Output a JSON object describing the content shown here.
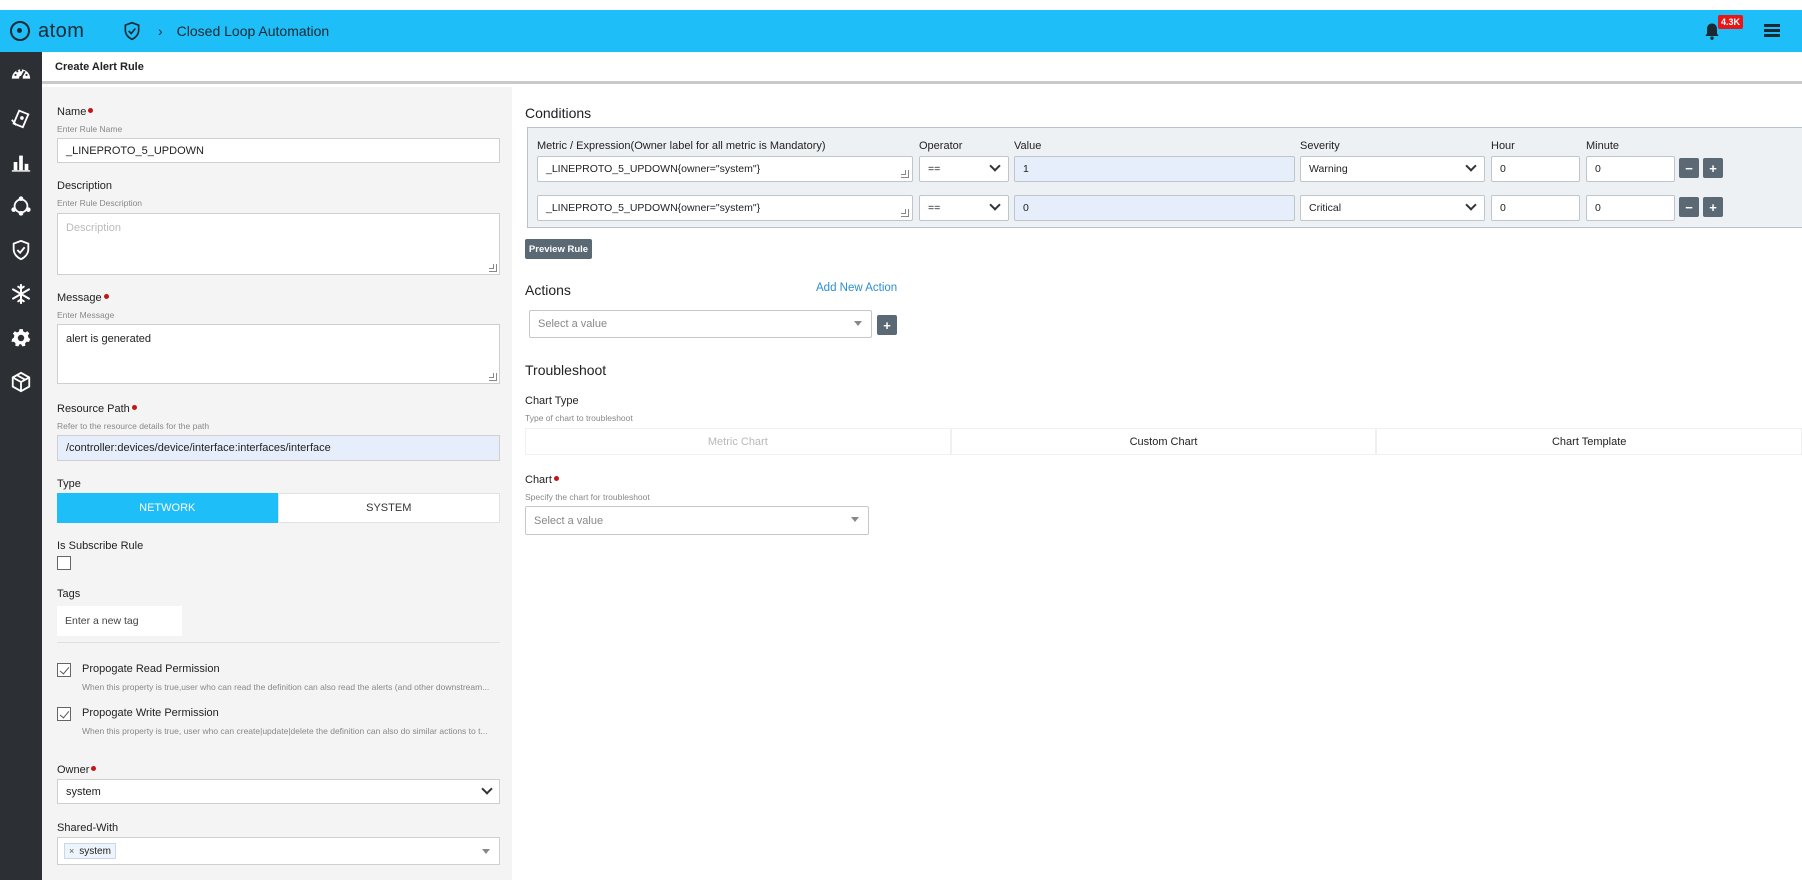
{
  "header": {
    "logo_text": "atom",
    "breadcrumb": "Closed Loop Automation",
    "notification_count": "4.3K"
  },
  "sidebar": {
    "items": [
      {
        "icon": "dashboard-icon"
      },
      {
        "icon": "devices-icon"
      },
      {
        "icon": "analytics-icon"
      },
      {
        "icon": "topology-icon"
      },
      {
        "icon": "shield-icon"
      },
      {
        "icon": "snowflake-icon"
      },
      {
        "icon": "gear-icon"
      },
      {
        "icon": "cube-icon"
      }
    ]
  },
  "page": {
    "title": "Create Alert Rule"
  },
  "form": {
    "name_label": "Name",
    "name_hint": "Enter Rule Name",
    "name_value": "_LINEPROTO_5_UPDOWN",
    "description_label": "Description",
    "description_hint": "Enter Rule Description",
    "description_placeholder": "Description",
    "message_label": "Message",
    "message_hint": "Enter Message",
    "message_value": "alert is generated",
    "resource_path_label": "Resource Path",
    "resource_path_hint": "Refer to the resource details for the path",
    "resource_path_value": "/controller:devices/device/interface:interfaces/interface",
    "type_label": "Type",
    "type_options": [
      "NETWORK",
      "SYSTEM"
    ],
    "type_selected": "NETWORK",
    "subscribe_label": "Is Subscribe Rule",
    "tags_label": "Tags",
    "tags_placeholder": "Enter a new tag",
    "read_perm_label": "Propogate Read Permission",
    "read_perm_desc": "When this property is true,user who can read the definition can also read the alerts (and other downstream...",
    "write_perm_label": "Propogate Write Permission",
    "write_perm_desc": "When this property is true, user who can create|update|delete the definition can also do similar actions to t...",
    "owner_label": "Owner",
    "owner_value": "system",
    "shared_label": "Shared-With",
    "shared_chip": "system",
    "shared_chip_remove": "×"
  },
  "conditions": {
    "title": "Conditions",
    "headers": {
      "metric": "Metric / Expression(Owner label for all metric is Mandatory)",
      "operator": "Operator",
      "value": "Value",
      "severity": "Severity",
      "hour": "Hour",
      "minute": "Minute"
    },
    "rows": [
      {
        "metric": "_LINEPROTO_5_UPDOWN{owner=\"system\"}",
        "operator": "==",
        "value": "1",
        "severity": "Warning",
        "hour": "0",
        "minute": "0"
      },
      {
        "metric": "_LINEPROTO_5_UPDOWN{owner=\"system\"}",
        "operator": "==",
        "value": "0",
        "severity": "Critical",
        "hour": "0",
        "minute": "0"
      }
    ],
    "remove_label": "−",
    "add_label": "+",
    "preview_label": "Preview Rule"
  },
  "actions": {
    "title": "Actions",
    "add_link": "Add New Action",
    "select_placeholder": "Select a value",
    "add_label": "+"
  },
  "troubleshoot": {
    "title": "Troubleshoot",
    "chart_type_label": "Chart Type",
    "chart_type_hint": "Type of chart to troubleshoot",
    "chart_types": [
      "Metric Chart",
      "Custom Chart",
      "Chart Template"
    ],
    "chart_label": "Chart",
    "chart_hint": "Specify the chart for troubleshoot",
    "chart_placeholder": "Select a value"
  },
  "colors": {
    "header_bg": "#1ebef8",
    "sidebar_bg": "#2c2f33",
    "button_dark": "#5b6975",
    "required_dot": "#c41616",
    "badge_red": "#e81616"
  }
}
